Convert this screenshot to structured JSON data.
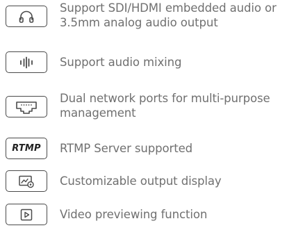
{
  "features": [
    {
      "icon": "headphones-icon",
      "text": "Support SDI/HDMI embedded audio or 3.5mm analog audio output"
    },
    {
      "icon": "audio-waveform-icon",
      "text": "Support audio mixing"
    },
    {
      "icon": "network-port-icon",
      "text": "Dual network ports for multi-purpose management"
    },
    {
      "icon": "rtmp-icon",
      "badge_text": "RTMP",
      "text": "RTMP Server supported"
    },
    {
      "icon": "display-settings-icon",
      "text": "Customizable output display"
    },
    {
      "icon": "play-button-icon",
      "text": "Video previewing function"
    }
  ],
  "colors": {
    "label_text": "#707070",
    "icon_stroke": "#4a4a4a",
    "badge_text": "#222222"
  }
}
